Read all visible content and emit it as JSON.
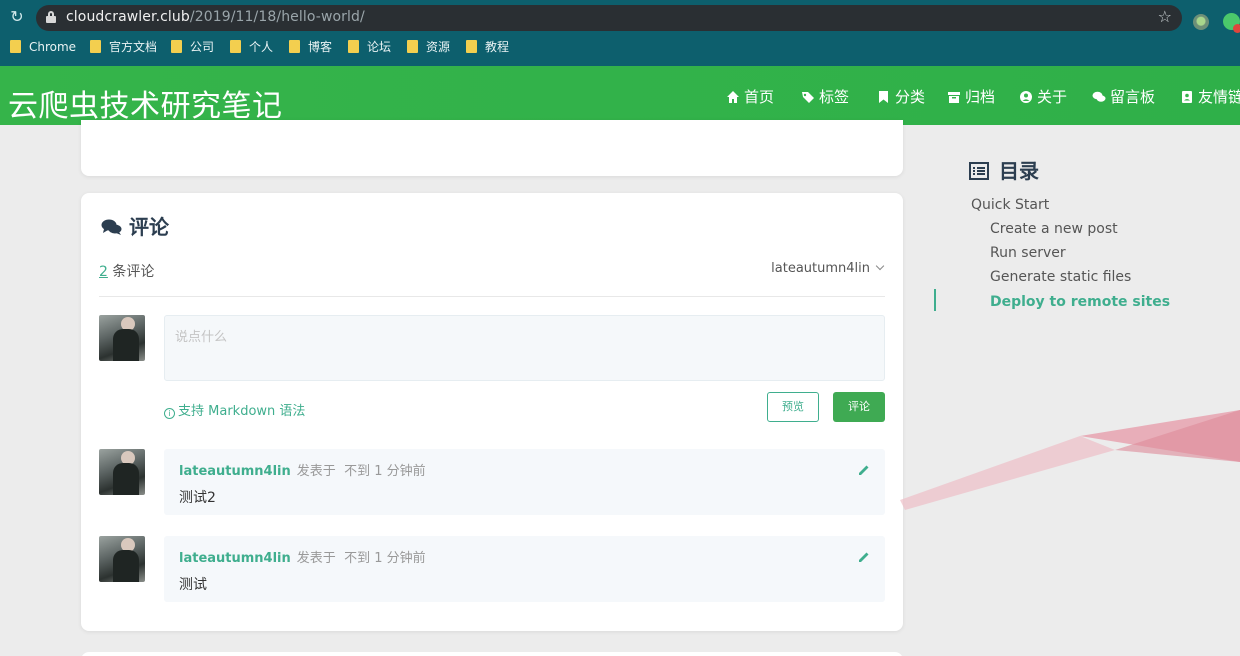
{
  "browser": {
    "url_host": "cloudcrawler.club",
    "url_path": "/2019/11/18/hello-world/",
    "bookmarks": [
      "Chrome",
      "官方文档",
      "公司",
      "个人",
      "博客",
      "论坛",
      "资源",
      "教程"
    ]
  },
  "site": {
    "title": "云爬虫技术研究笔记",
    "nav": [
      "首页",
      "标签",
      "分类",
      "归档",
      "关于",
      "留言板",
      "友情链"
    ]
  },
  "comments": {
    "heading": "评论",
    "count": "2",
    "count_suffix": "条评论",
    "current_user": "lateautumn4lin",
    "placeholder": "说点什么",
    "markdown_hint": "支持 Markdown 语法",
    "preview_label": "预览",
    "submit_label": "评论",
    "items": [
      {
        "author": "lateautumn4lin",
        "posted_label": "发表于",
        "time": "不到 1 分钟前",
        "text": "测试2"
      },
      {
        "author": "lateautumn4lin",
        "posted_label": "发表于",
        "time": "不到 1 分钟前",
        "text": "测试"
      }
    ]
  },
  "toc": {
    "title": "目录",
    "items": [
      "Quick Start",
      "Create a new post",
      "Run server",
      "Generate static files",
      "Deploy to remote sites"
    ],
    "active_index": 4
  },
  "colors": {
    "header_green": "#35b44a",
    "accent": "#3fae8e",
    "browser_teal": "#0d5f6d"
  }
}
